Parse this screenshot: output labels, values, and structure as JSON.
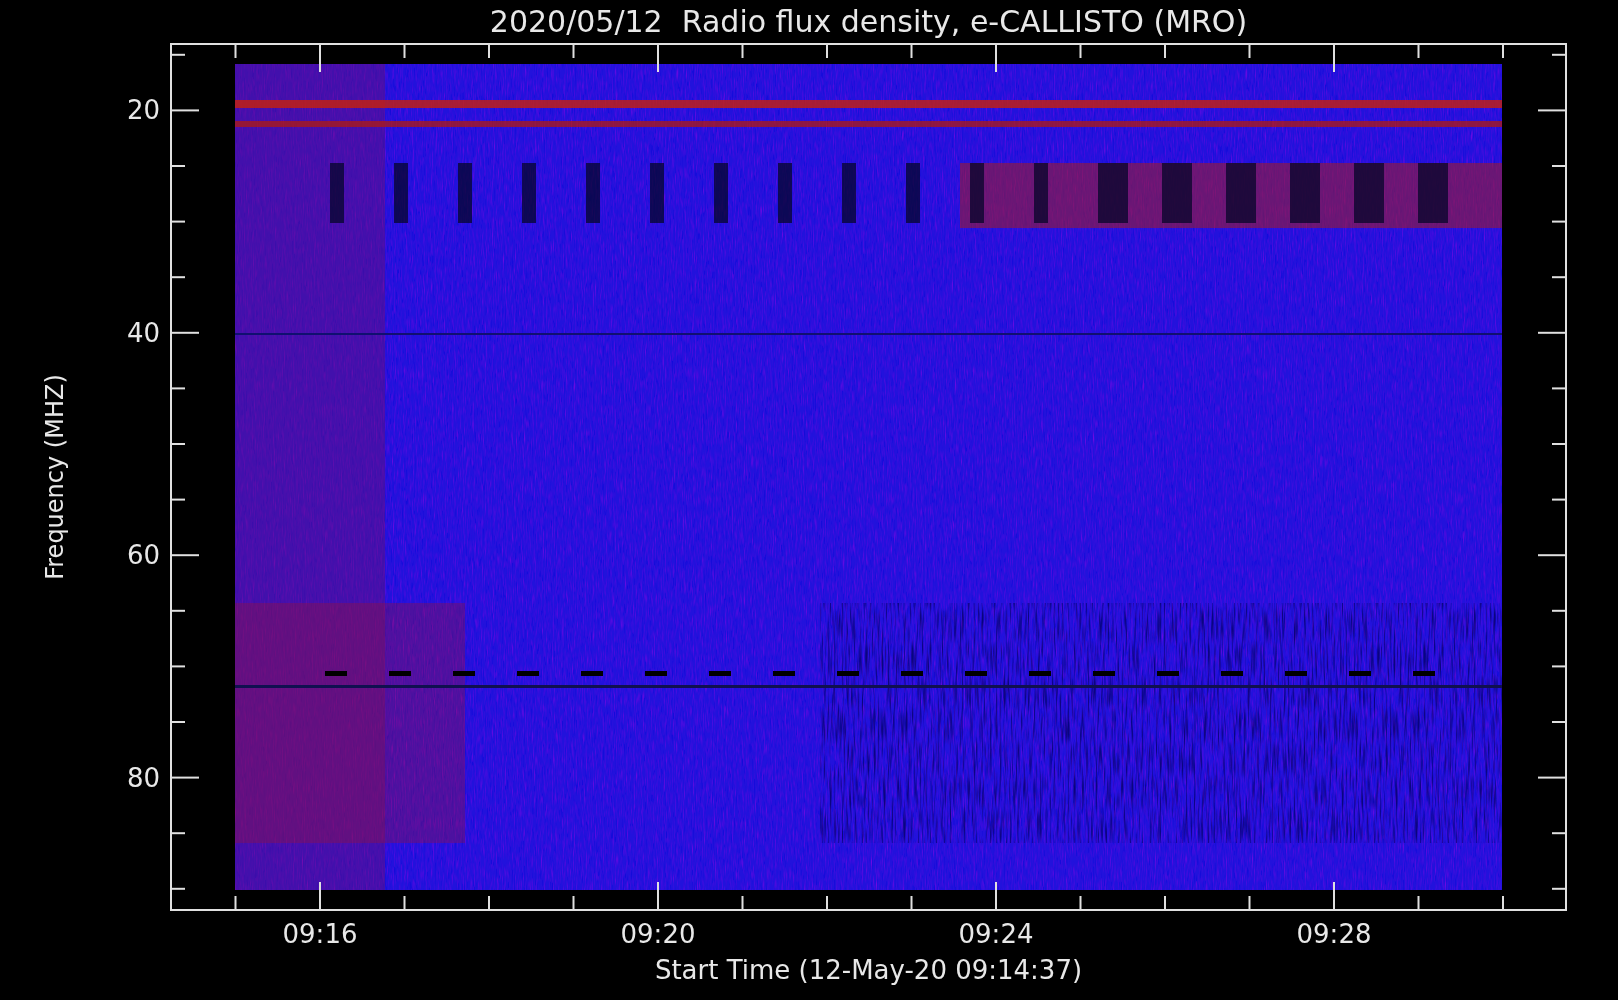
{
  "title": "2020/05/12  Radio flux density, e-CALLISTO (MRO)",
  "y_axis": {
    "label": "Frequency (MHZ)",
    "ticks": [
      "20",
      "40",
      "60",
      "80"
    ]
  },
  "x_axis": {
    "label": "Start Time (12-May-20 09:14:37)",
    "ticks": [
      "09:16",
      "09:20",
      "09:24",
      "09:28"
    ]
  }
}
